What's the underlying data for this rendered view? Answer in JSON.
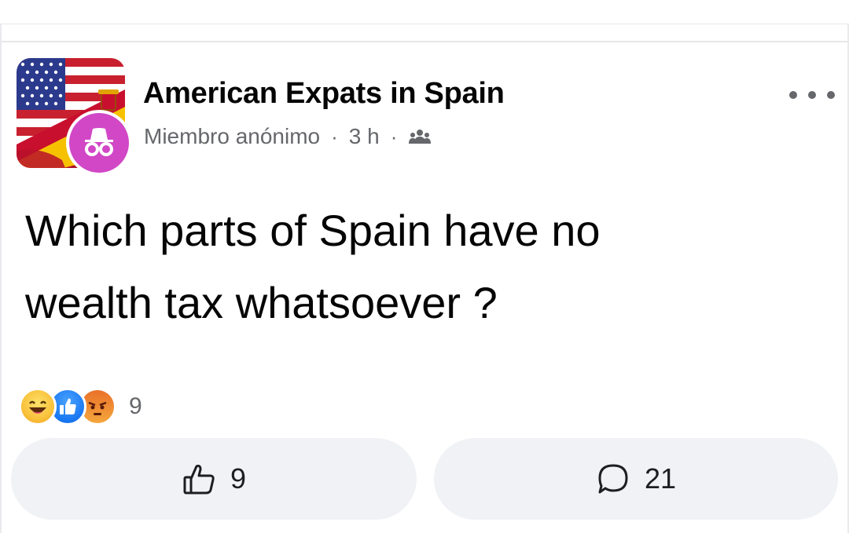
{
  "post": {
    "group_name": "American Expats in Spain",
    "author": "Miembro anónimo",
    "separator": "·",
    "time": "3 h",
    "audience_icon": "group-audience-icon",
    "text_line1": "Which parts of Spain have no",
    "text_line2": "wealth tax whatsoever ?"
  },
  "reactions": {
    "types": [
      "haha",
      "like",
      "angry"
    ],
    "count": "9"
  },
  "actions": {
    "like_count": "9",
    "comment_count": "21"
  },
  "colors": {
    "member_avatar": "#d147c6",
    "action_bg": "#f0f2f5",
    "meta_text": "#65676b"
  }
}
